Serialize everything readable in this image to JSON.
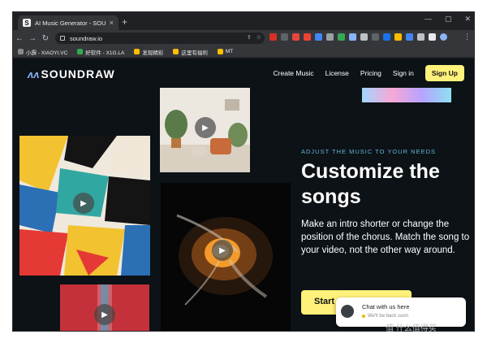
{
  "browser": {
    "tab_title": "AI Music Generator - SOUNDR",
    "tab_favicon": "S",
    "new_tab": "+",
    "url": "soundraw.io",
    "back": "←",
    "forward": "→",
    "reload": "↻",
    "minimize": "—",
    "maximize": "▢",
    "close": "✕",
    "tab_close": "×",
    "menu": "⋮"
  },
  "bookmarks": [
    {
      "label": "小霹 - XIAOYI.VC",
      "color": "#8a8a8a"
    },
    {
      "label": "好软件 - X1G.LA",
      "color": "#34a853"
    },
    {
      "label": "发现精彩",
      "color": "#fbbc04"
    },
    {
      "label": "这里有福利",
      "color": "#fbbc04"
    },
    {
      "label": "MT",
      "color": "#fbbc04"
    }
  ],
  "site": {
    "logo_mark": "ʌʌ",
    "logo_text": "SOUNDRAW",
    "nav": {
      "create_music": "Create Music",
      "license": "License",
      "pricing": "Pricing",
      "sign_in": "Sign in",
      "sign_up": "Sign Up"
    },
    "hero": {
      "tag": "ADJUST THE MUSIC TO YOUR NEEDS",
      "title": "Customize the songs",
      "description": "Make an intro shorter or change the position of the chorus. Match the song to your video, not the other way around.",
      "cta": "Start"
    },
    "chat": {
      "title": "Chat with us here",
      "subtitle": "We'll be back soon"
    },
    "play_glyph": "▶"
  },
  "watermark": "值 什么值得买"
}
